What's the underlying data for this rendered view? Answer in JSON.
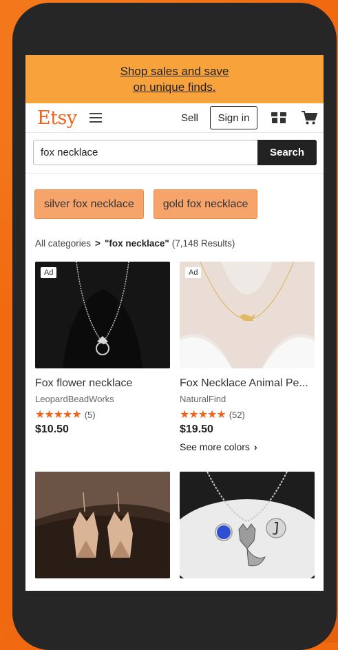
{
  "promo": {
    "line1": "Shop sales and save",
    "line2": "on unique finds."
  },
  "header": {
    "logo": "Etsy",
    "sell_label": "Sell",
    "signin_label": "Sign in"
  },
  "search": {
    "value": "fox necklace",
    "button_label": "Search"
  },
  "chips": [
    "silver fox necklace",
    "gold fox necklace"
  ],
  "breadcrumb": {
    "root": "All categories",
    "separator": ">",
    "query": "\"fox necklace\"",
    "count": "(7,148 Results)"
  },
  "products": [
    {
      "ad": "Ad",
      "title": "Fox flower necklace",
      "shop": "LeopardBeadWorks",
      "stars": "★★★★★",
      "reviews": "(5)",
      "price": "$10.50"
    },
    {
      "ad": "Ad",
      "title": "Fox Necklace Animal Pe...",
      "shop": "NaturalFind",
      "stars": "★★★★★",
      "reviews": "(52)",
      "price": "$19.50",
      "more": "See more colors"
    },
    {
      "title": "",
      "shop": "",
      "price": ""
    },
    {
      "title": "",
      "shop": "",
      "price": ""
    }
  ],
  "colors": {
    "brand": "#f1641e",
    "promo_bg": "#f7a23b",
    "chip_bg": "#f7a46a",
    "page_bg": "#f16a10",
    "phone": "#262626"
  }
}
